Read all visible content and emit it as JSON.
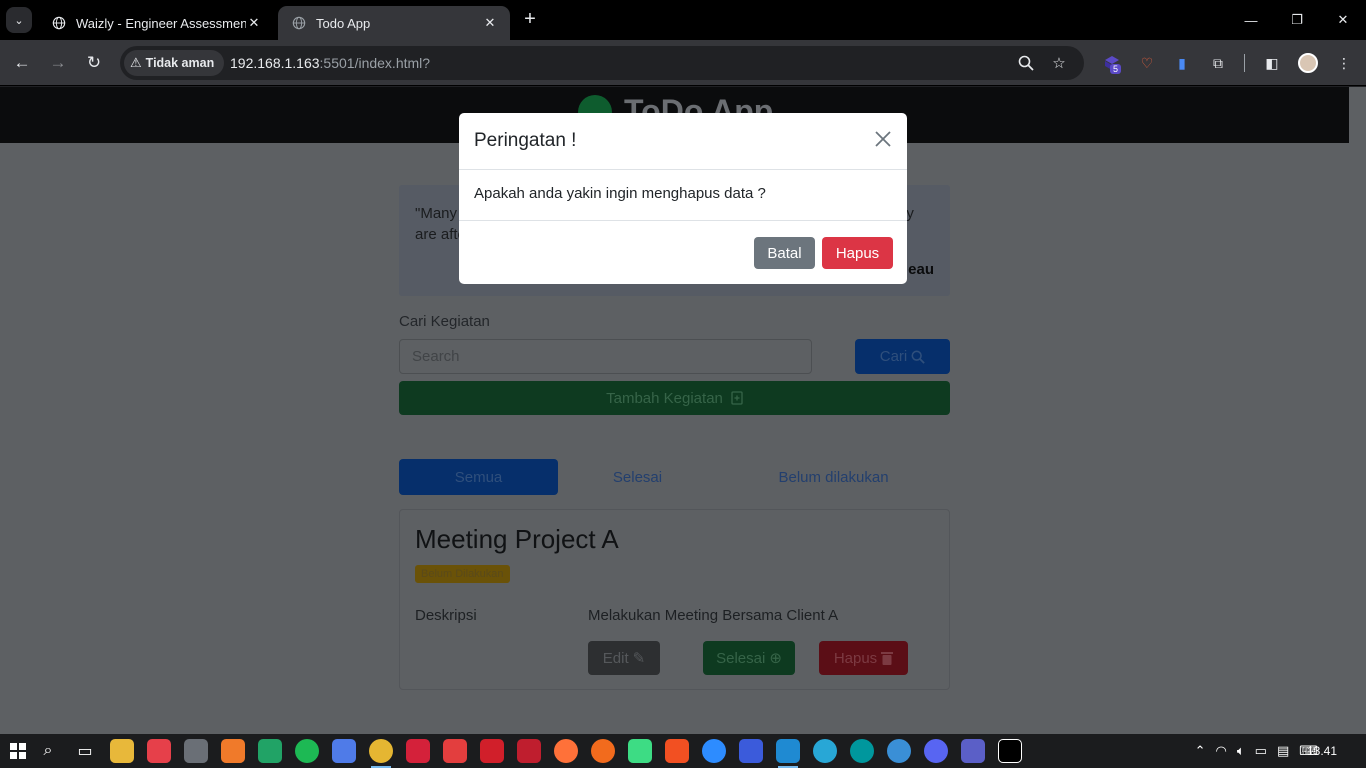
{
  "browser": {
    "tabs": [
      {
        "title": "Waizly - Engineer Assessment",
        "active": false
      },
      {
        "title": "Todo App",
        "active": true
      }
    ],
    "security_label": "Tidak aman",
    "url_host": "192.168.1.163",
    "url_rest": ":5501/index.html?",
    "extension_badge": "5"
  },
  "app": {
    "brand": "ToDo App",
    "quote_text": "\"Many men go fishing all of their lives without knowing that it is not fish they are after.\"",
    "quote_author": "eau",
    "search_label": "Cari Kegiatan",
    "search_placeholder": "Search",
    "search_button": "Cari",
    "add_button": "Tambah Kegiatan",
    "filters": [
      "Semua",
      "Selesai",
      "Belum dilakukan"
    ],
    "card": {
      "title": "Meeting Project A",
      "status": "Belum Dilakukan",
      "desc_label": "Deskripsi",
      "desc_value": "Melakukan Meeting Bersama Client A",
      "edit": "Edit",
      "done": "Selesai",
      "delete": "Hapus"
    }
  },
  "modal": {
    "title": "Peringatan !",
    "body": "Apakah anda yakin ingin menghapus data ?",
    "cancel": "Batal",
    "confirm": "Hapus"
  },
  "taskbar": {
    "time": "13.41"
  },
  "colors": {
    "danger": "#dc3545",
    "secondary": "#6c757d",
    "primary": "#0d6efd",
    "success": "#198754"
  }
}
